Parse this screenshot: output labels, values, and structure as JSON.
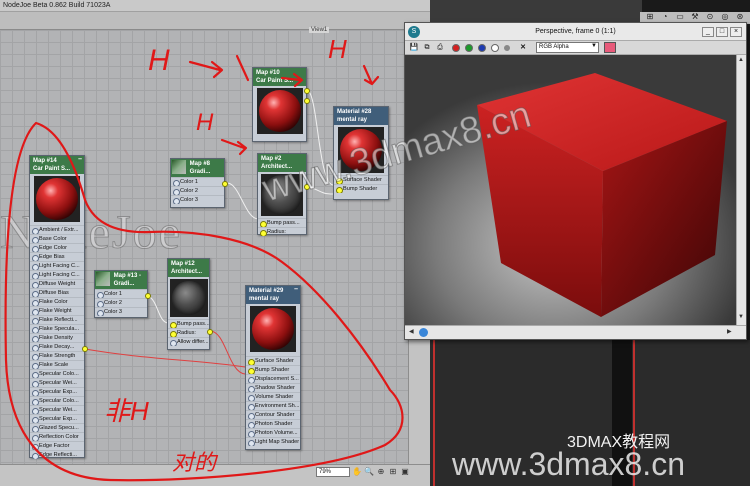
{
  "app": {
    "title": "NodeJoe Beta 0.862 Build 71023A",
    "view_label": "View1",
    "zoom": "79%"
  },
  "nodes": {
    "map14": {
      "title": "Map #14",
      "subtitle": "Car Paint S...",
      "slots": [
        "Ambient / Extr...",
        "Base Color",
        "Edge Color",
        "Edge Bias",
        "Light Facing C...",
        "Light Facing C...",
        "Diffuse Weight",
        "Diffuse Bias",
        "Flake Color",
        "Flake Weight",
        "Flake Reflecti...",
        "Flake Specula...",
        "Flake Density",
        "Flake Decay...",
        "Flake Strength",
        "Flake Scale",
        "Specular Colo...",
        "Specular Wei...",
        "Specular Exp...",
        "Specular Colo...",
        "Specular Wei...",
        "Specular Exp...",
        "Glazed Specu...",
        "Reflection Color",
        "Edge Factor",
        "Edge Reflecti..."
      ]
    },
    "map10": {
      "title": "Map #10",
      "subtitle": "Car Paint S..."
    },
    "mat28": {
      "title": "Material #28",
      "subtitle": "mental ray",
      "slots": [
        "Surface Shader",
        "Bump Shader"
      ]
    },
    "map8": {
      "title": "Map #8",
      "subtitle": "Gradi...",
      "slots": [
        "Color 1",
        "Color 2",
        "Color 3"
      ]
    },
    "map2": {
      "title": "Map #2",
      "subtitle": "Architect...",
      "slots": [
        "Bump pass...",
        "Radius:"
      ]
    },
    "map13": {
      "title": "Map #13 -",
      "subtitle": "Gradi...",
      "slots": [
        "Color 1",
        "Color 2",
        "Color 3"
      ]
    },
    "map12": {
      "title": "Map #12",
      "subtitle": "Architect...",
      "slots": [
        "Bump pass...",
        "Radius:",
        "Allow differ..."
      ]
    },
    "mat29": {
      "title": "Material #29",
      "subtitle": "mental ray",
      "slots": [
        "Surface Shader",
        "Bump Shader",
        "Displacement S...",
        "Shadow Shader",
        "Volume Shader",
        "Environment Sh...",
        "Contour Shader",
        "Photon Shader",
        "Photon Volume...",
        "Light Map Shader"
      ]
    }
  },
  "perspective": {
    "title": "Perspective, frame 0 (1:1)",
    "channel_option": "RGB Alpha",
    "min_label": "_",
    "max_label": "□",
    "close_label": "×"
  },
  "watermarks": {
    "diagonal": "www.3dmax8.cn",
    "bottom_cn": "3DMAX教程网",
    "bottom_url": "www.3dmax8.cn"
  },
  "annotations": {
    "h1": "H",
    "h2": "H",
    "h3": "H",
    "fei_h": "非H",
    "cn_note": "对的"
  },
  "colors": {
    "node_green": "#3d7a48",
    "node_blue": "#405e7a",
    "port_yellow": "#ffff33",
    "annotation_red": "#e01818",
    "cube_red": "#c01818"
  }
}
